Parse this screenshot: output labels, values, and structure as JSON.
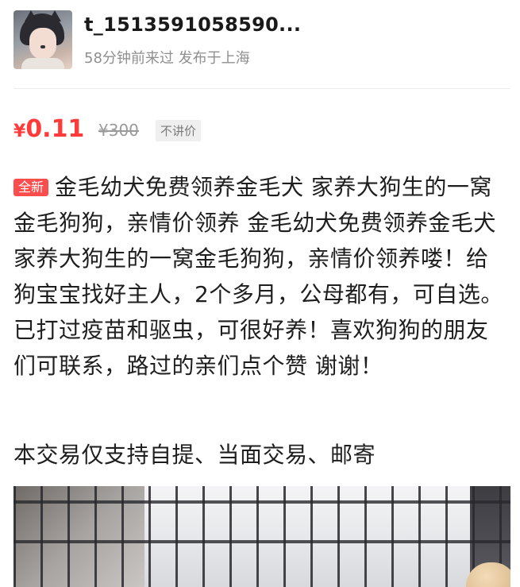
{
  "header": {
    "username": "t_1513591058590...",
    "meta": "58分钟前来过 发布于上海"
  },
  "price": {
    "currency": "¥",
    "value": "0.11",
    "original": "¥300",
    "bargain_tag": "不讲价",
    "accent_color": "#ff3a3a"
  },
  "listing": {
    "condition_badge": "全新",
    "description": "金毛幼犬免费领养金毛犬 家养大狗生的一窝金毛狗狗，亲情价领养 金毛幼犬免费领养金毛犬 家养大狗生的一窝金毛狗狗，亲情价领养喽！给狗宝宝找好主人，2个多月，公母都有，可自选。已打过疫苗和驱虫，可很好养！喜欢狗狗的朋友们可联系，路过的亲们点个赞 谢谢！",
    "trade_methods": "本交易仅支持自提、当面交易、邮寄"
  },
  "icons": {
    "avatar": "user-avatar",
    "photo": "puppy-photo"
  }
}
